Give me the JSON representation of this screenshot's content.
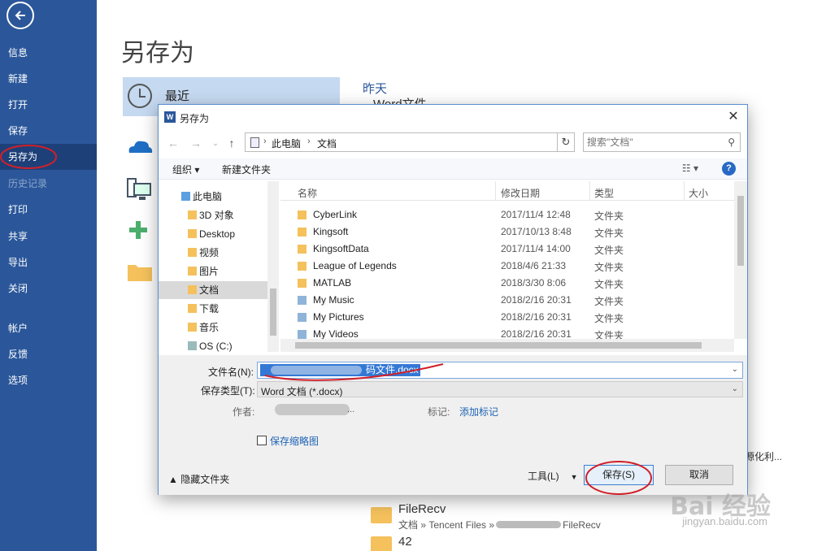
{
  "sidebar": {
    "items": [
      {
        "label": "信息"
      },
      {
        "label": "新建"
      },
      {
        "label": "打开"
      },
      {
        "label": "保存"
      },
      {
        "label": "另存为"
      },
      {
        "label": "历史记录"
      },
      {
        "label": "打印"
      },
      {
        "label": "共享"
      },
      {
        "label": "导出"
      },
      {
        "label": "关闭"
      },
      {
        "label": "帐户"
      },
      {
        "label": "反馈"
      },
      {
        "label": "选项"
      }
    ]
  },
  "backstage": {
    "title": "另存为",
    "recent_label": "最近",
    "yesterday_label": "昨天",
    "bg_file1": "Word文件",
    "bg_snippet": "源化利...",
    "bg_filerecv": "FileRecv",
    "bg_filerecv_path_a": "文档 » Tencent Files »",
    "bg_filerecv_path_b": "FileRecv",
    "bg_42": "42"
  },
  "dialog": {
    "title": "另存为",
    "word_badge": "W",
    "close_glyph": "✕",
    "breadcrumb": [
      "此电脑",
      "文档"
    ],
    "search_placeholder": "搜索\"文档\"",
    "toolbar": {
      "organize": "组织 ▾",
      "new_folder": "新建文件夹",
      "help": "?"
    },
    "nav_tree": [
      {
        "label": "此电脑",
        "icon": "pc"
      },
      {
        "label": "3D 对象",
        "icon": "folder"
      },
      {
        "label": "Desktop",
        "icon": "folder"
      },
      {
        "label": "视频",
        "icon": "folder"
      },
      {
        "label": "图片",
        "icon": "folder"
      },
      {
        "label": "文档",
        "icon": "folder"
      },
      {
        "label": "下载",
        "icon": "folder"
      },
      {
        "label": "音乐",
        "icon": "folder"
      },
      {
        "label": "OS (C:)",
        "icon": "drive"
      }
    ],
    "columns": {
      "name": "名称",
      "date": "修改日期",
      "type": "类型",
      "size": "大小"
    },
    "files": [
      {
        "name": "CyberLink",
        "date": "2017/11/4 12:48",
        "type": "文件夹"
      },
      {
        "name": "Kingsoft",
        "date": "2017/10/13 8:48",
        "type": "文件夹"
      },
      {
        "name": "KingsoftData",
        "date": "2017/11/4 14:00",
        "type": "文件夹"
      },
      {
        "name": "League of Legends",
        "date": "2018/4/6 21:33",
        "type": "文件夹"
      },
      {
        "name": "MATLAB",
        "date": "2018/3/30 8:06",
        "type": "文件夹"
      },
      {
        "name": "My Music",
        "date": "2018/2/16 20:31",
        "type": "文件夹"
      },
      {
        "name": "My Pictures",
        "date": "2018/2/16 20:31",
        "type": "文件夹"
      },
      {
        "name": "My Videos",
        "date": "2018/2/16 20:31",
        "type": "文件夹"
      }
    ],
    "filename_label": "文件名(N):",
    "filename_value": "码文件.docx",
    "filetype_label": "保存类型(T):",
    "filetype_value": "Word 文档 (*.docx)",
    "author_label": "作者:",
    "author_value": "...",
    "tags_label": "标记:",
    "tags_link": "添加标记",
    "thumbnail_label": "保存缩略图",
    "hide_folders": "▲  隐藏文件夹",
    "tools": "工具(L)",
    "save": "保存(S)",
    "cancel": "取消"
  },
  "watermark": {
    "text": "Bai 经验",
    "url": "jingyan.baidu.com"
  },
  "colors": {
    "sidebar": "#2b579a",
    "accent": "#3478d5",
    "annotation": "#d0202a"
  }
}
